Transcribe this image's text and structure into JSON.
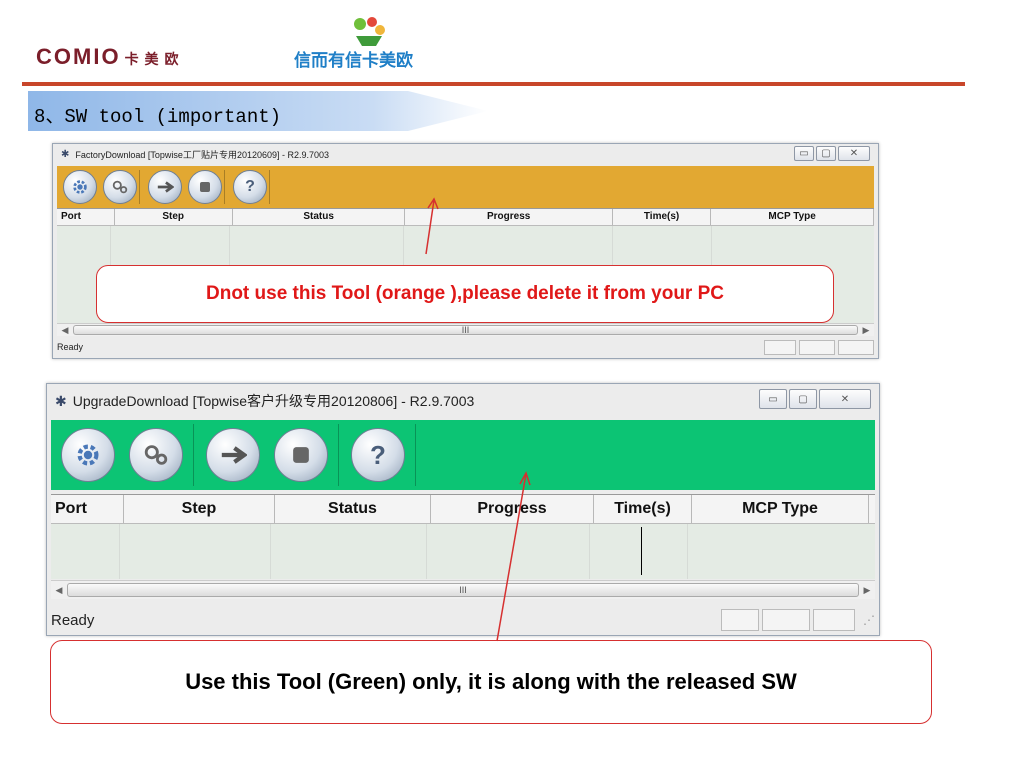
{
  "header": {
    "logo_text": "COMIO",
    "logo_cn": "卡美欧",
    "brand_slogan": "信而有信卡美欧",
    "slide_title": "8、SW tool (important)"
  },
  "colors": {
    "header_line": "#c8462a",
    "factory_toolbar": "#e2a832",
    "upgrade_toolbar": "#0cc474",
    "callout_border": "#d63030",
    "warning_text": "#e01818"
  },
  "factory_window": {
    "title": "FactoryDownload [Topwise工厂贴片专用20120609] - R2.9.7003",
    "toolbar_icons": [
      "settings-gear-icon",
      "multi-gear-icon",
      "start-arrow-icon",
      "stop-icon",
      "help-icon"
    ],
    "help_glyph": "?",
    "columns": [
      "Port",
      "Step",
      "Status",
      "Progress",
      "Time(s)",
      "MCP Type"
    ],
    "scroll_thumb": "III",
    "status": "Ready"
  },
  "upgrade_window": {
    "title": "UpgradeDownload [Topwise客户升级专用20120806] - R2.9.7003",
    "toolbar_icons": [
      "settings-gear-icon",
      "multi-gear-icon",
      "start-arrow-icon",
      "stop-icon",
      "help-icon"
    ],
    "help_glyph": "?",
    "columns": [
      "Port",
      "Step",
      "Status",
      "Progress",
      "Time(s)",
      "MCP Type"
    ],
    "scroll_thumb": "III",
    "status": "Ready"
  },
  "callouts": {
    "factory_note": "Dnot use this Tool (orange ),please delete it  from your PC",
    "upgrade_note": "Use this Tool (Green) only, it is along with the released SW"
  }
}
